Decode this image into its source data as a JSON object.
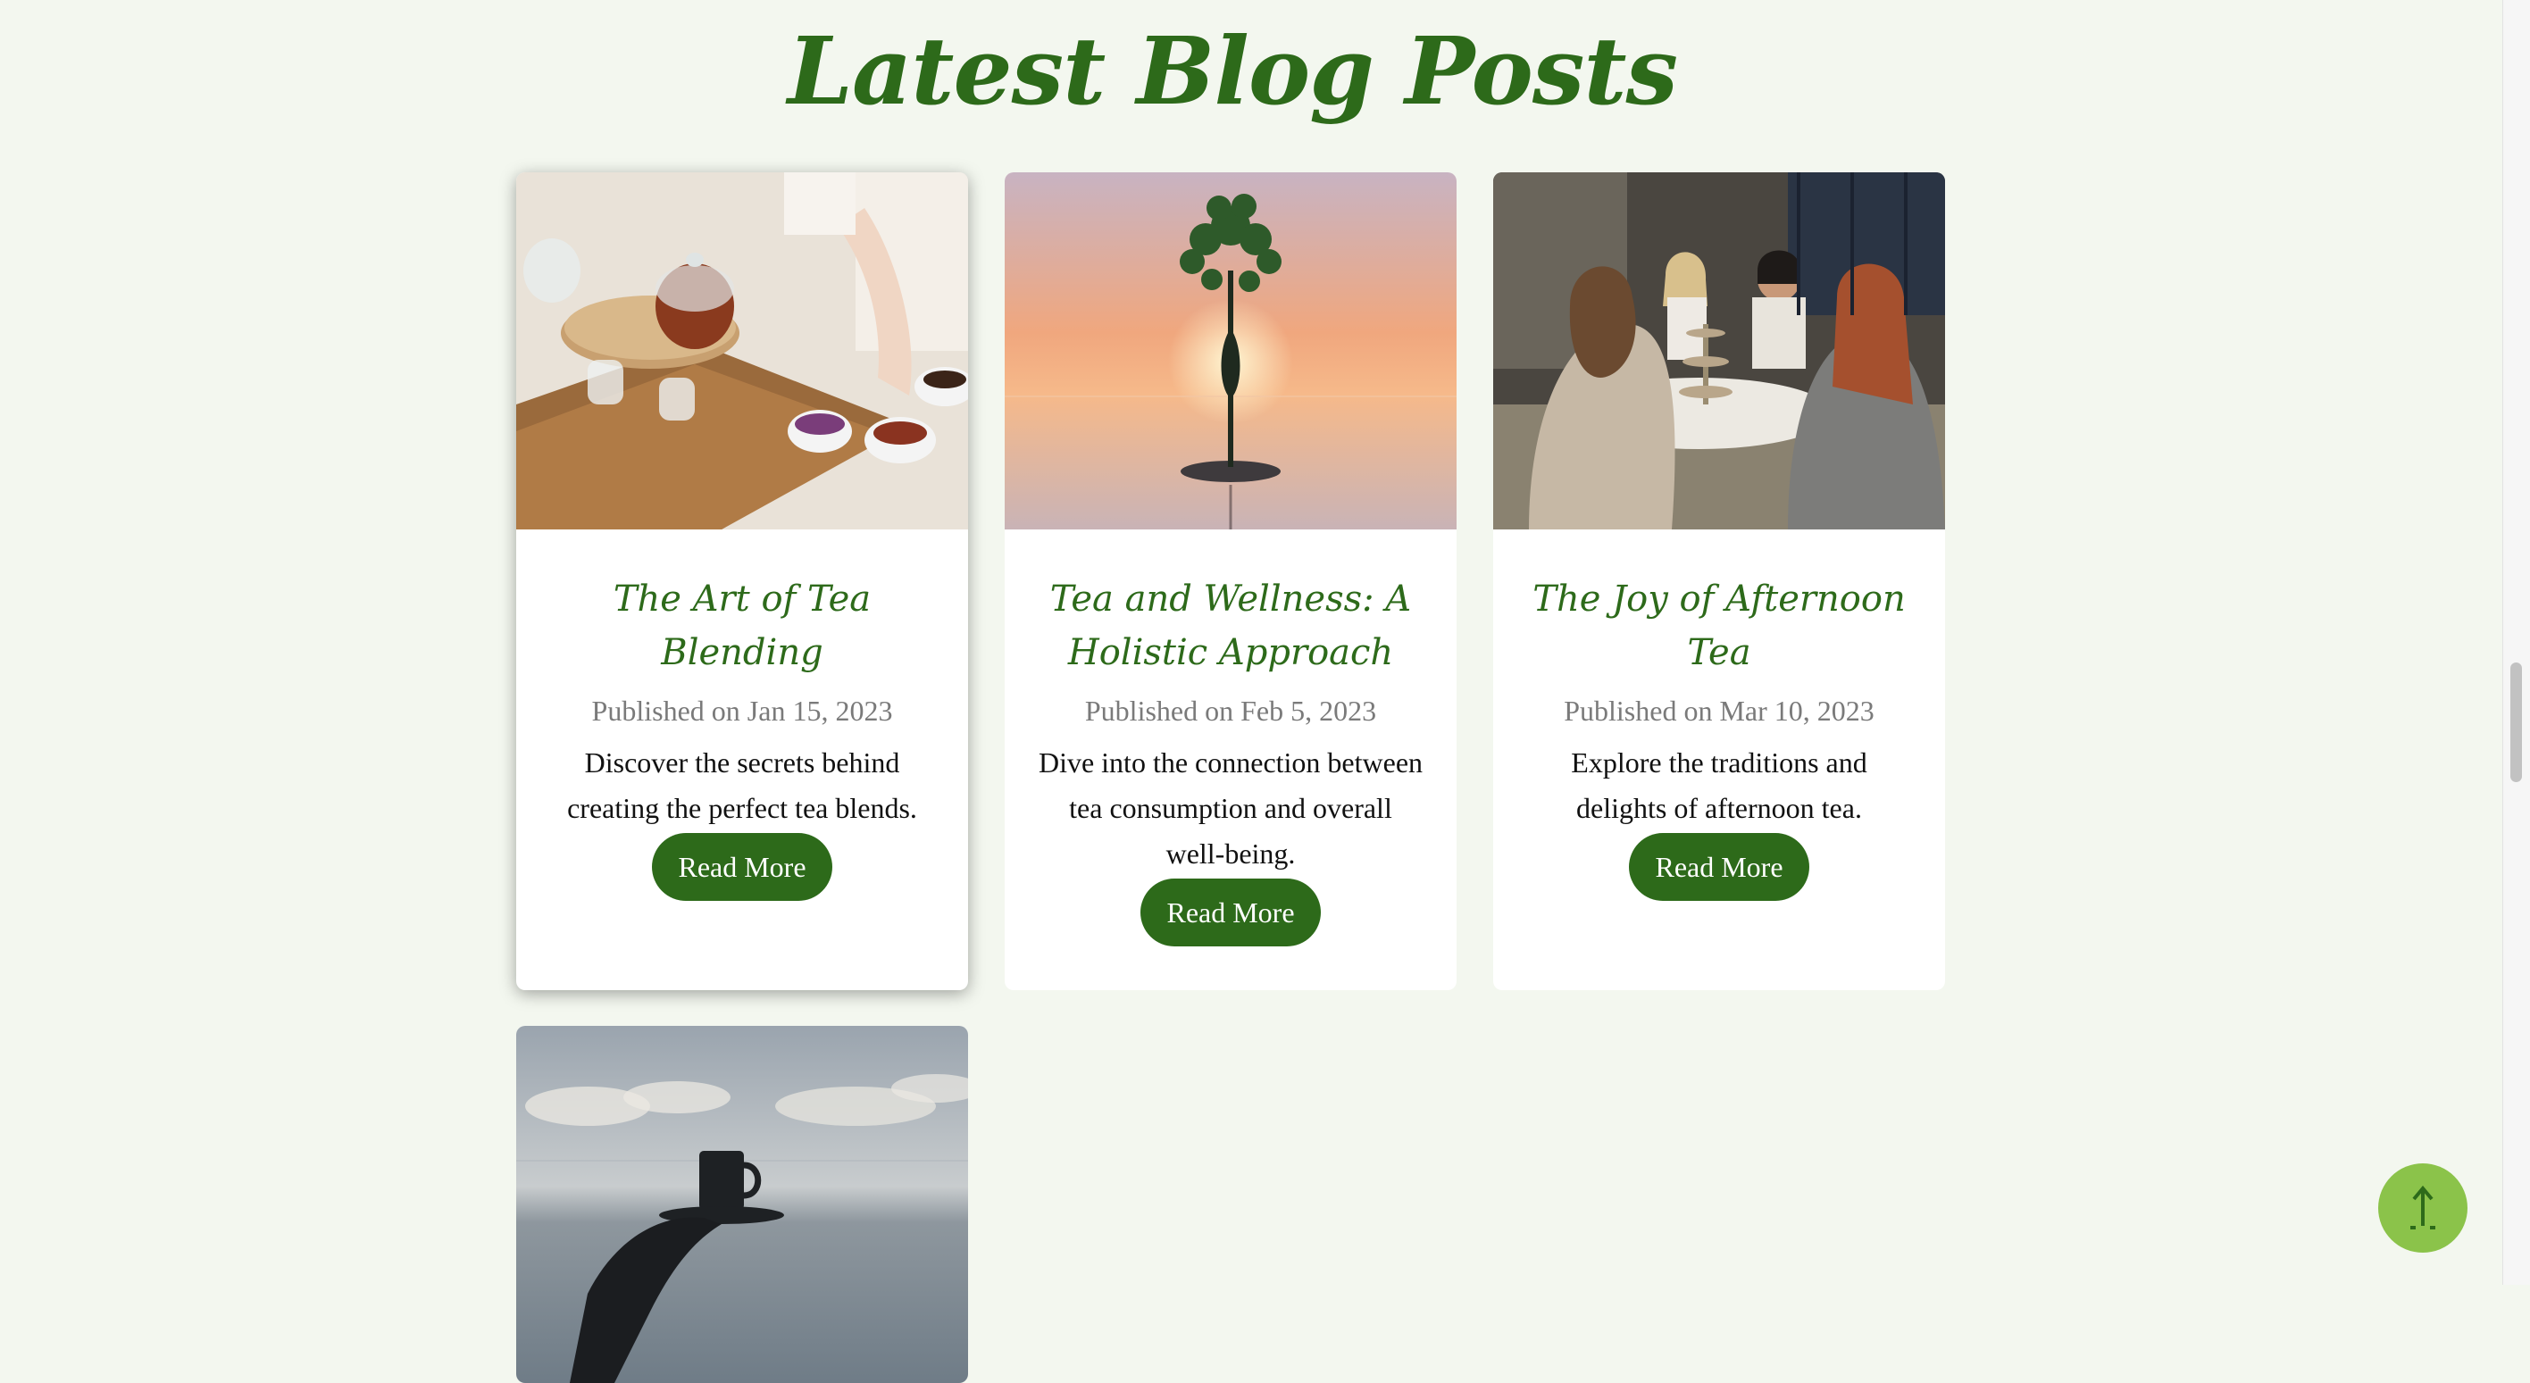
{
  "page": {
    "title": "Latest Blog Posts"
  },
  "posts": [
    {
      "title": "The Art of Tea Blending",
      "date": "Published on Jan 15, 2023",
      "excerpt": "Discover the secrets behind creating the perfect tea blends.",
      "button": "Read More"
    },
    {
      "title": "Tea and Wellness: A Holistic Approach",
      "date": "Published on Feb 5, 2023",
      "excerpt": "Dive into the connection between tea consumption and overall well-being.",
      "button": "Read More"
    },
    {
      "title": "The Joy of Afternoon Tea",
      "date": "Published on Mar 10, 2023",
      "excerpt": "Explore the traditions and delights of afternoon tea.",
      "button": "Read More"
    }
  ],
  "back_to_top": {
    "icon": "arrow-up-icon"
  },
  "colors": {
    "accent": "#2d6a1a",
    "background": "#f3f7ef",
    "back_to_top": "#8bc34a"
  }
}
